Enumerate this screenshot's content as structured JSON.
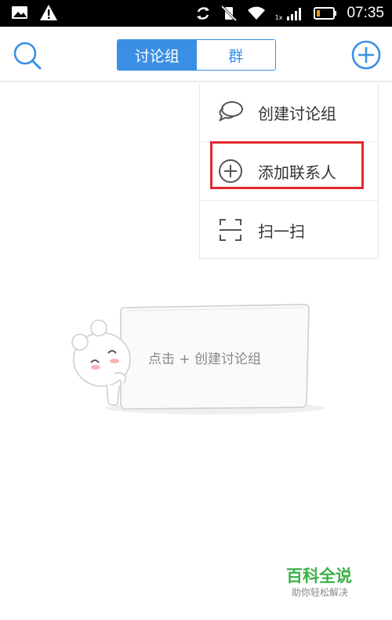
{
  "status_bar": {
    "time": "07:35",
    "network_label": "1x"
  },
  "header": {
    "tabs": [
      {
        "label": "讨论组",
        "active": true
      },
      {
        "label": "群",
        "active": false
      }
    ]
  },
  "menu": {
    "items": [
      {
        "label": "创建讨论组",
        "icon": "chat-bubbles-icon"
      },
      {
        "label": "添加联系人",
        "icon": "plus-circle-icon"
      },
      {
        "label": "扫一扫",
        "icon": "scan-icon"
      }
    ]
  },
  "empty_state": {
    "text": "点击 + 创建讨论组"
  },
  "watermark": {
    "title": "百科全说",
    "subtitle": "助你轻松解决"
  },
  "colors": {
    "accent": "#3a8fe5",
    "highlight": "#e1292f",
    "brand": "#3cb04a"
  }
}
